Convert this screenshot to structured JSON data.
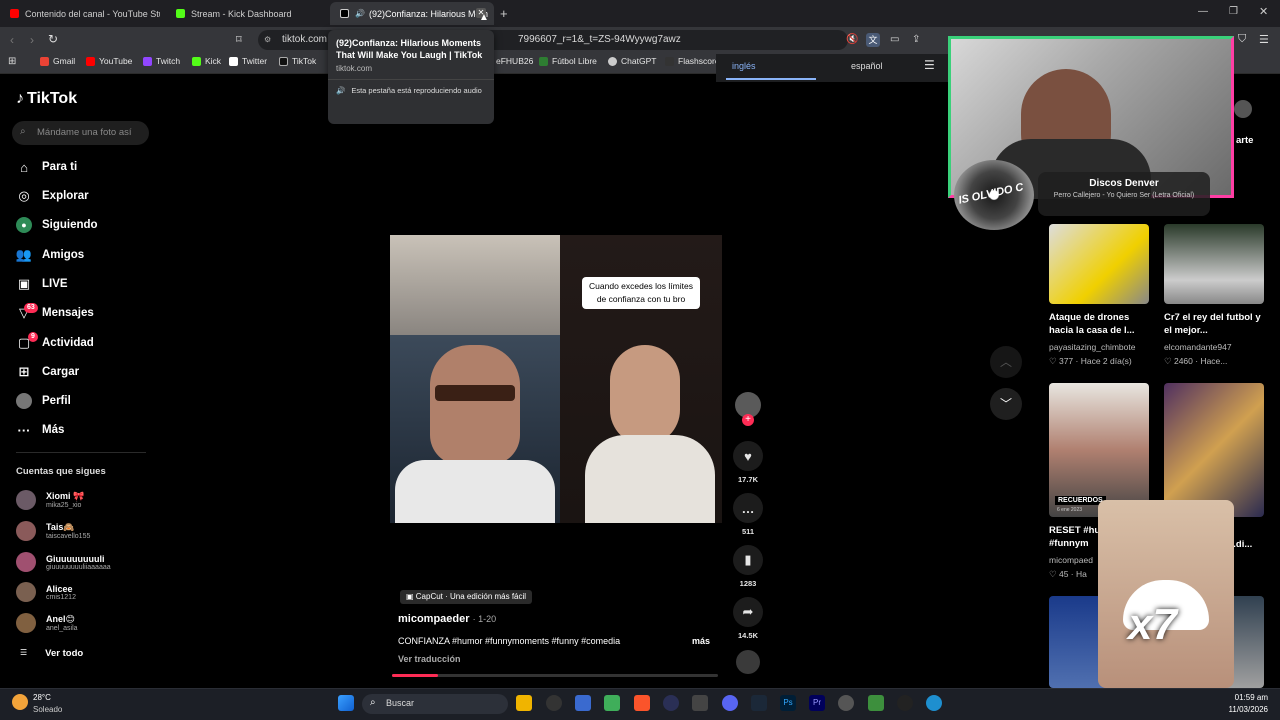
{
  "browser": {
    "tabs": [
      {
        "title": "Contenido del canal - YouTube Studio",
        "color": "#ff0000"
      },
      {
        "title": "Stream - Kick Dashboard",
        "color": "#53fc18"
      },
      {
        "title": "(92)Confianza: Hilarious Mom",
        "color": "#ffffff"
      }
    ],
    "url": "tiktok.com",
    "url_tail": "7996607_r=1&_t=ZS-94Wyywg7awz",
    "bookmarks": [
      "Gmail",
      "YouTube",
      "Twitch",
      "Kick",
      "Twitter",
      "TikTok",
      "eFHUB26",
      "Fútbol Libre",
      "ChatGPT",
      "Flashscore"
    ],
    "translate": {
      "from": "inglés",
      "to": "español"
    }
  },
  "tooltip": {
    "title": "(92)Confianza: Hilarious Moments That Will Make You Laugh | TikTok",
    "domain": "tiktok.com",
    "audio_note": "Esta pestaña está reproduciendo audio"
  },
  "tiktok": {
    "logo": "TikTok",
    "search_placeholder": "Mándame una foto así",
    "nav": [
      {
        "label": "Para ti",
        "icon": "home-icon"
      },
      {
        "label": "Explorar",
        "icon": "compass-icon"
      },
      {
        "label": "Siguiendo",
        "icon": "following-icon"
      },
      {
        "label": "Amigos",
        "icon": "friends-icon"
      },
      {
        "label": "LIVE",
        "icon": "live-icon"
      },
      {
        "label": "Mensajes",
        "icon": "messages-icon",
        "badge": "63"
      },
      {
        "label": "Actividad",
        "icon": "activity-icon",
        "badge": "9"
      },
      {
        "label": "Cargar",
        "icon": "upload-icon"
      },
      {
        "label": "Perfil",
        "icon": "profile-icon"
      },
      {
        "label": "Más",
        "icon": "more-icon"
      }
    ],
    "following_title": "Cuentas que sigues",
    "following": [
      {
        "name": "Xiomi 🎀",
        "handle": "mika25_xio",
        "color": "#6b5a66"
      },
      {
        "name": "Tais🙈",
        "handle": "taiscavello155",
        "color": "#8a5a5a"
      },
      {
        "name": "Giuuuuuuuuli",
        "handle": "giuuuuuuuuliiaaaaaa",
        "color": "#a05070"
      },
      {
        "name": "Alicee",
        "handle": "cmis1212",
        "color": "#7a6050"
      },
      {
        "name": "Anel😊",
        "handle": "anel_asila",
        "color": "#806040"
      }
    ],
    "see_all": "Ver todo",
    "video": {
      "caption_overlay": "Cuando excedes los límites de confianza con tu bro",
      "capcut": "CapCut · Una edición más fácil",
      "author": "micompaeder",
      "date": "· 1-20",
      "description": "CONFIANZA #humor #funnymoments #funny #comedia",
      "more": "más",
      "translate": "Ver traducción",
      "likes": "17.7K",
      "comments": "511",
      "saves": "1283",
      "shares": "14.5K"
    },
    "share_label": "arte",
    "cards": [
      {
        "title": "Ataque de drones hacia la casa de l...",
        "user": "payasitazing_chimbote",
        "stat": "♡ 377 · Hace 2 día(s)"
      },
      {
        "title": "Cr7 el rey del futbol y el mejor...",
        "user": "elcomandante947",
        "stat": "♡ 2460 · Hace..."
      },
      {
        "title": "RESET #hu #funnym",
        "user": "micompaed",
        "stat": "♡ 45 · Ha"
      },
      {
        "title": "...di...",
        "user": "",
        "stat": ""
      }
    ],
    "card_badge": "RECUERDOS",
    "card_badge_date": "6 ene 2023"
  },
  "stream_overlay": {
    "song_title": "Discos Denver",
    "song_sub": "Perro Callejero - Yo Quiero Ser (Letra Oficial)",
    "vinyl_text": "IS OLVIDO C",
    "emote_text": "x7"
  },
  "taskbar": {
    "weather_temp": "28°C",
    "weather_desc": "Soleado",
    "search": "Buscar",
    "time": "01:59 am",
    "date": "11/03/2026"
  }
}
